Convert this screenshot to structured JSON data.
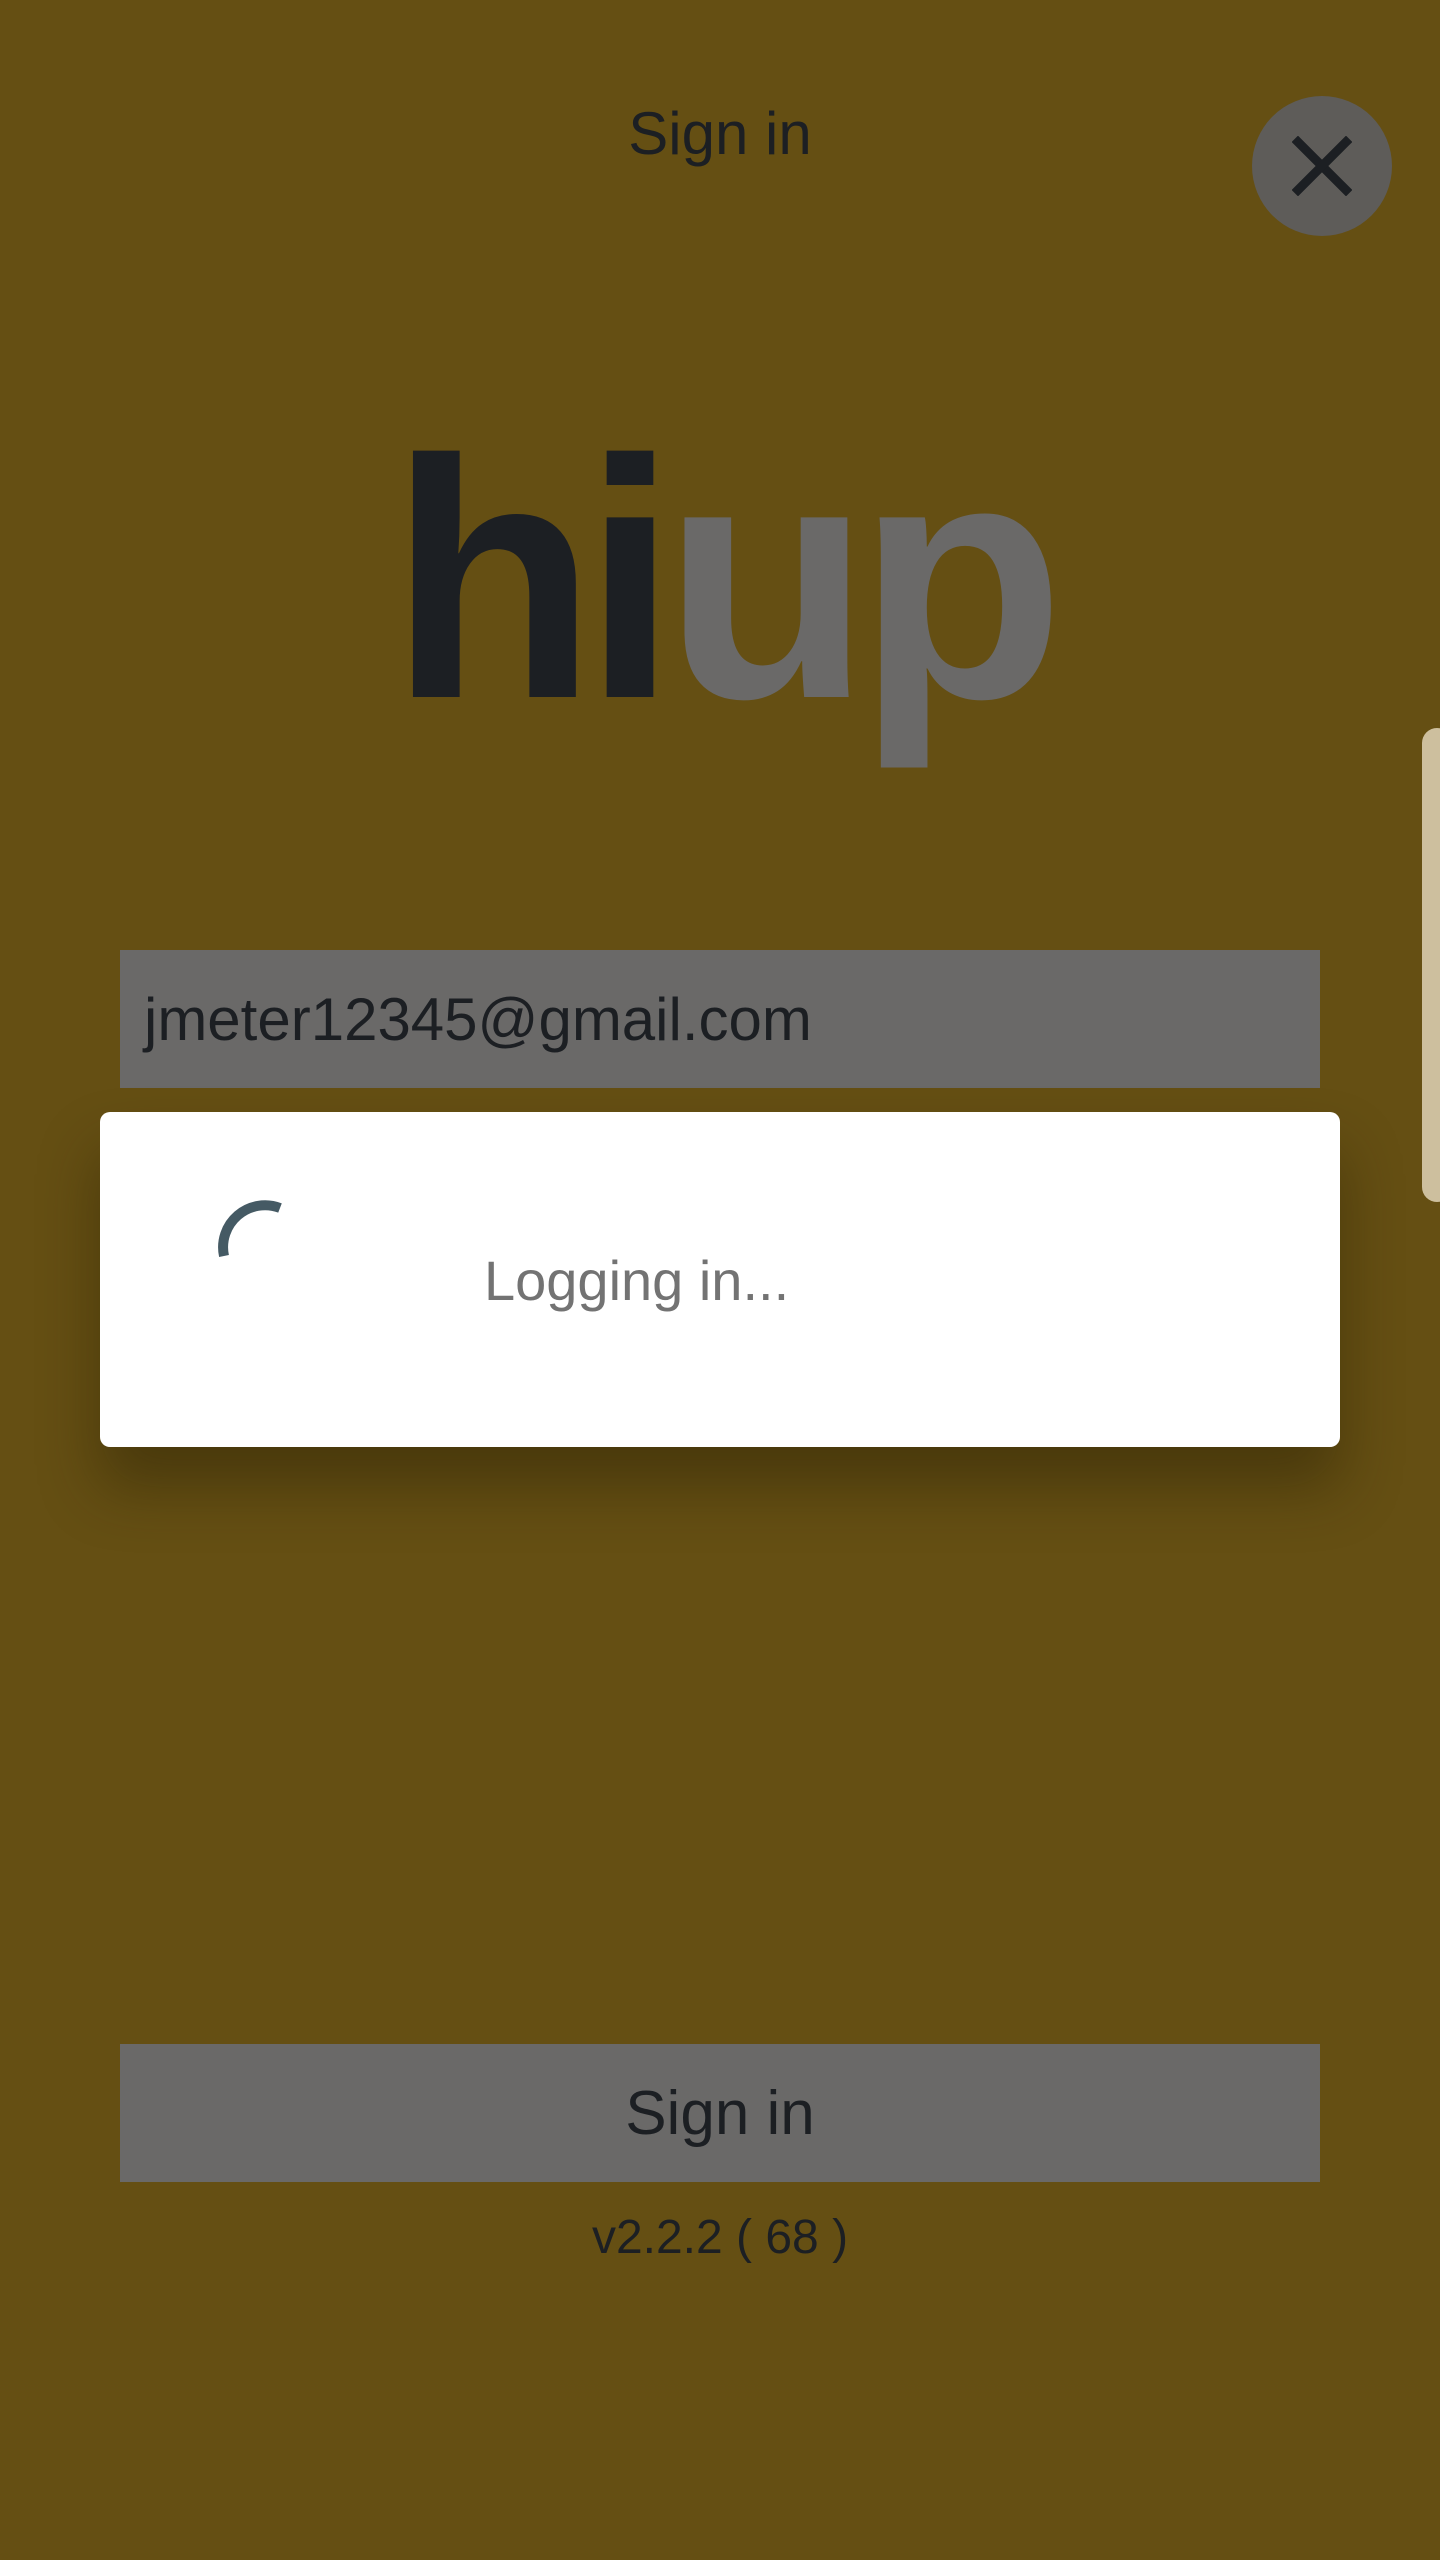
{
  "header": {
    "title": "Sign in",
    "close_icon": "close-icon"
  },
  "logo": {
    "part1": "hi",
    "part2": "up"
  },
  "form": {
    "email_value": "jmeter12345@gmail.com",
    "signin_label": "Sign in",
    "version": "v2.2.2 ( 68 )"
  },
  "dialog": {
    "message": "Logging in...",
    "spinner_icon": "loading-spinner-icon"
  },
  "colors": {
    "background": "#654f13",
    "field_gray": "#6a6968",
    "dark_text": "#1c1f23",
    "spinner": "#455a64"
  }
}
